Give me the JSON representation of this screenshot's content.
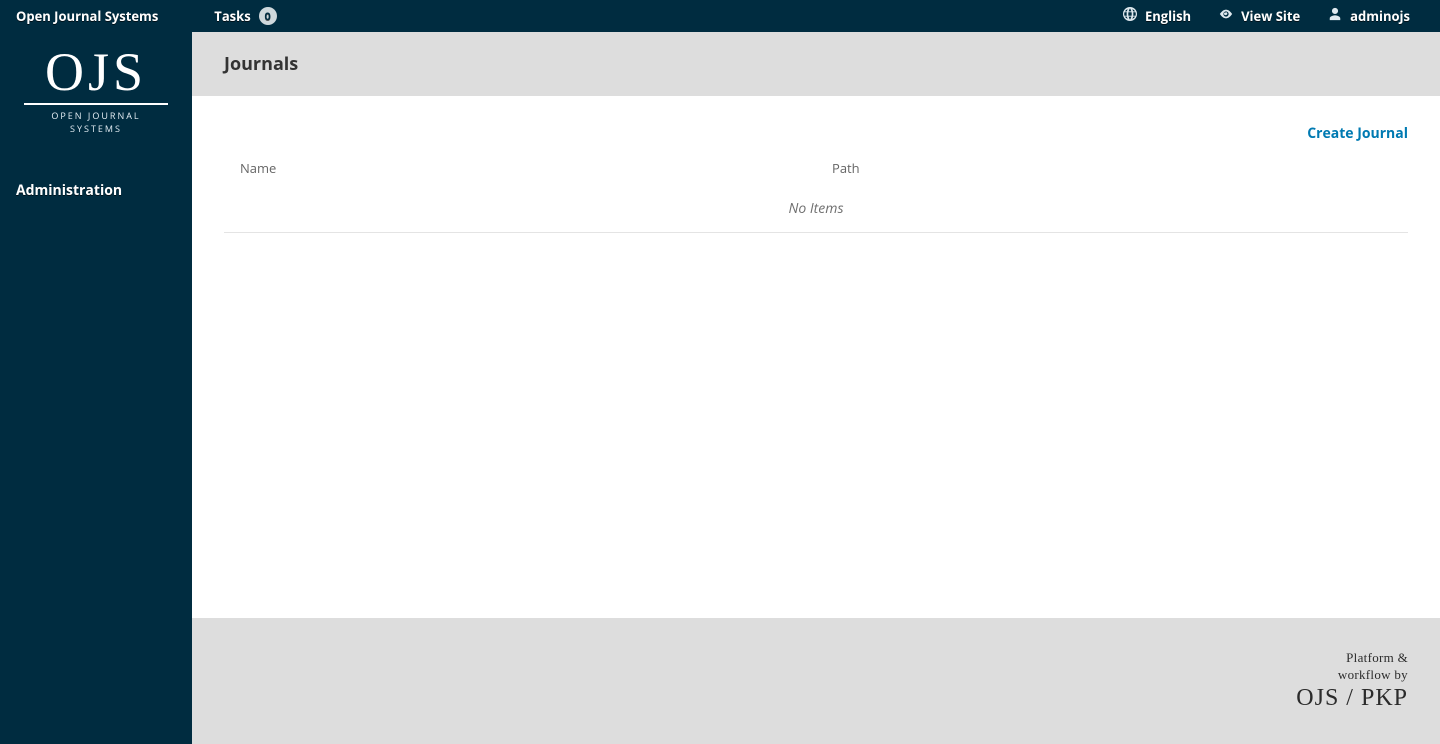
{
  "topbar": {
    "brand": "Open Journal Systems",
    "tasks_label": "Tasks",
    "tasks_count": "0",
    "language_label": "English",
    "view_site_label": "View Site",
    "user_label": "adminojs"
  },
  "sidebar": {
    "logo_text": "OJS",
    "logo_subtext": "OPEN JOURNAL SYSTEMS",
    "items": [
      {
        "label": "Administration"
      }
    ]
  },
  "page": {
    "title": "Journals",
    "create_button": "Create Journal",
    "columns": {
      "name": "Name",
      "path": "Path"
    },
    "empty_text": "No Items"
  },
  "footer": {
    "line1a": "Platform &",
    "line1b": "workflow by",
    "mark": "OJS / PKP"
  }
}
